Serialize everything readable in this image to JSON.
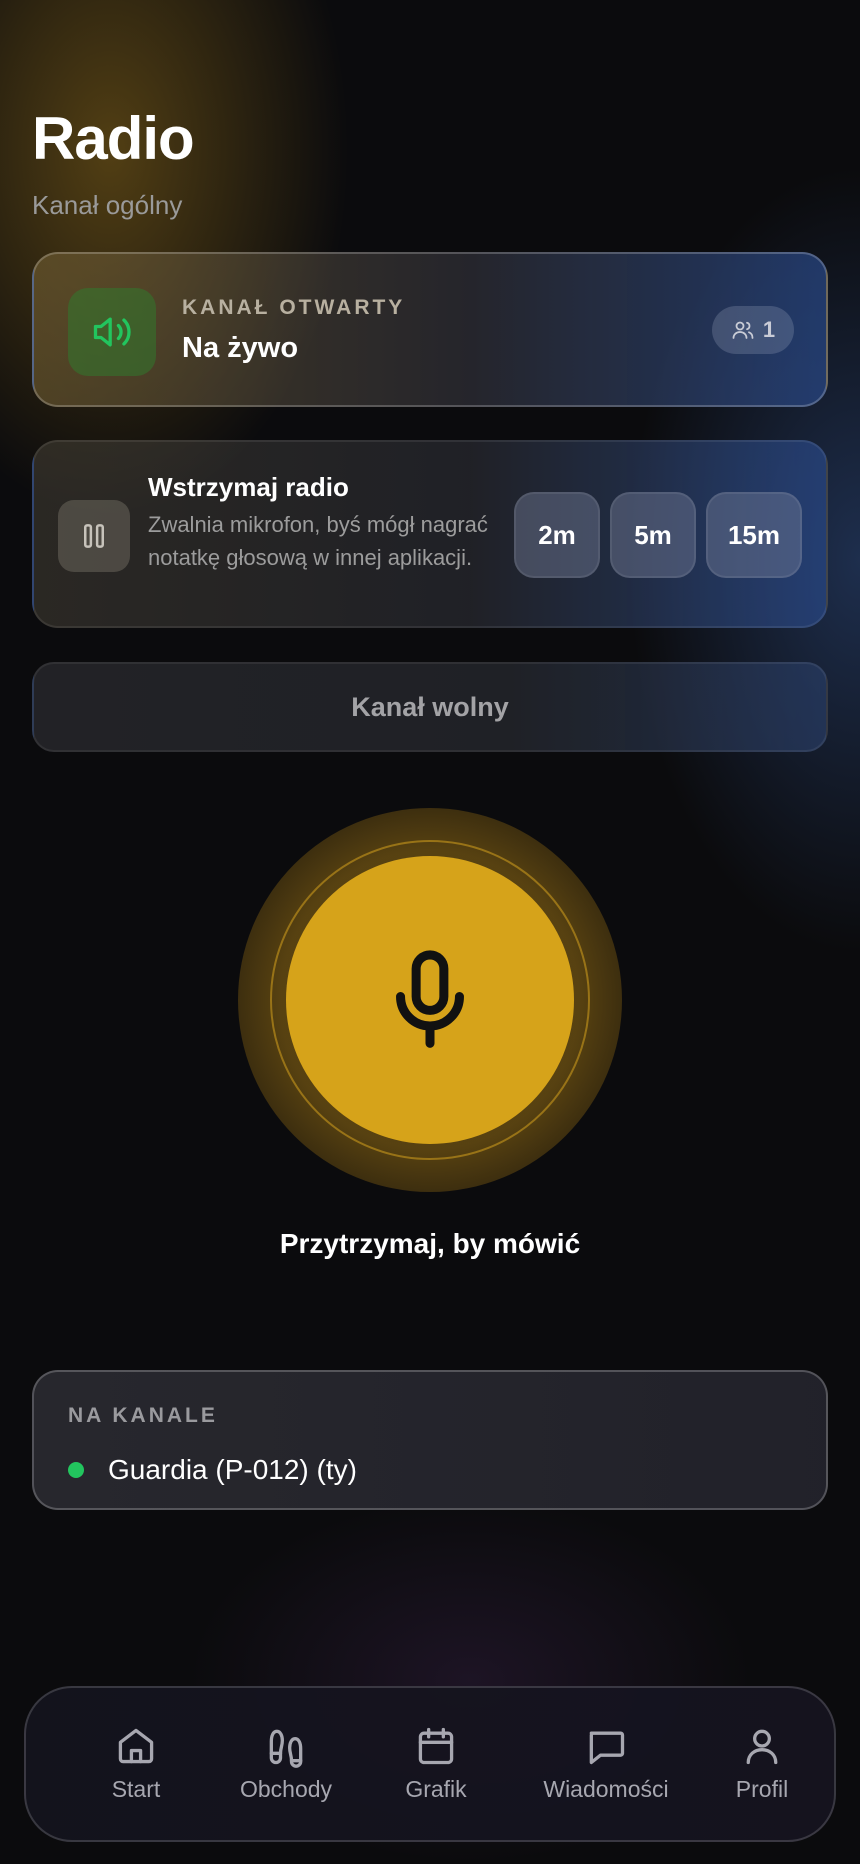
{
  "header": {
    "title": "Radio",
    "subtitle": "Kanał ogólny"
  },
  "status_card": {
    "kicker": "KANAŁ OTWARTY",
    "status": "Na żywo",
    "icon": "speaker-icon",
    "users_count": "1",
    "accent_color": "#22c55e"
  },
  "pause_card": {
    "title": "Wstrzymaj radio",
    "description": "Zwalnia mikrofon, byś mógł nagrać notatkę głosową w innej aplikacji.",
    "options": [
      "2m",
      "5m",
      "15m"
    ]
  },
  "channel_state": "Kanał wolny",
  "push_to_talk": {
    "label": "Przytrzymaj, by mówić",
    "color": "#d6a31a",
    "icon": "microphone-icon"
  },
  "on_channel": {
    "kicker": "NA KANALE",
    "members": [
      {
        "name": "Guardia (P-012) (ty)",
        "status_color": "#22c55e"
      }
    ]
  },
  "nav": {
    "items": [
      {
        "label": "Start",
        "icon": "home-icon"
      },
      {
        "label": "Obchody",
        "icon": "footprints-icon"
      },
      {
        "label": "Grafik",
        "icon": "calendar-icon"
      },
      {
        "label": "Wiadomości",
        "icon": "message-icon"
      },
      {
        "label": "Profil",
        "icon": "user-icon"
      }
    ]
  }
}
